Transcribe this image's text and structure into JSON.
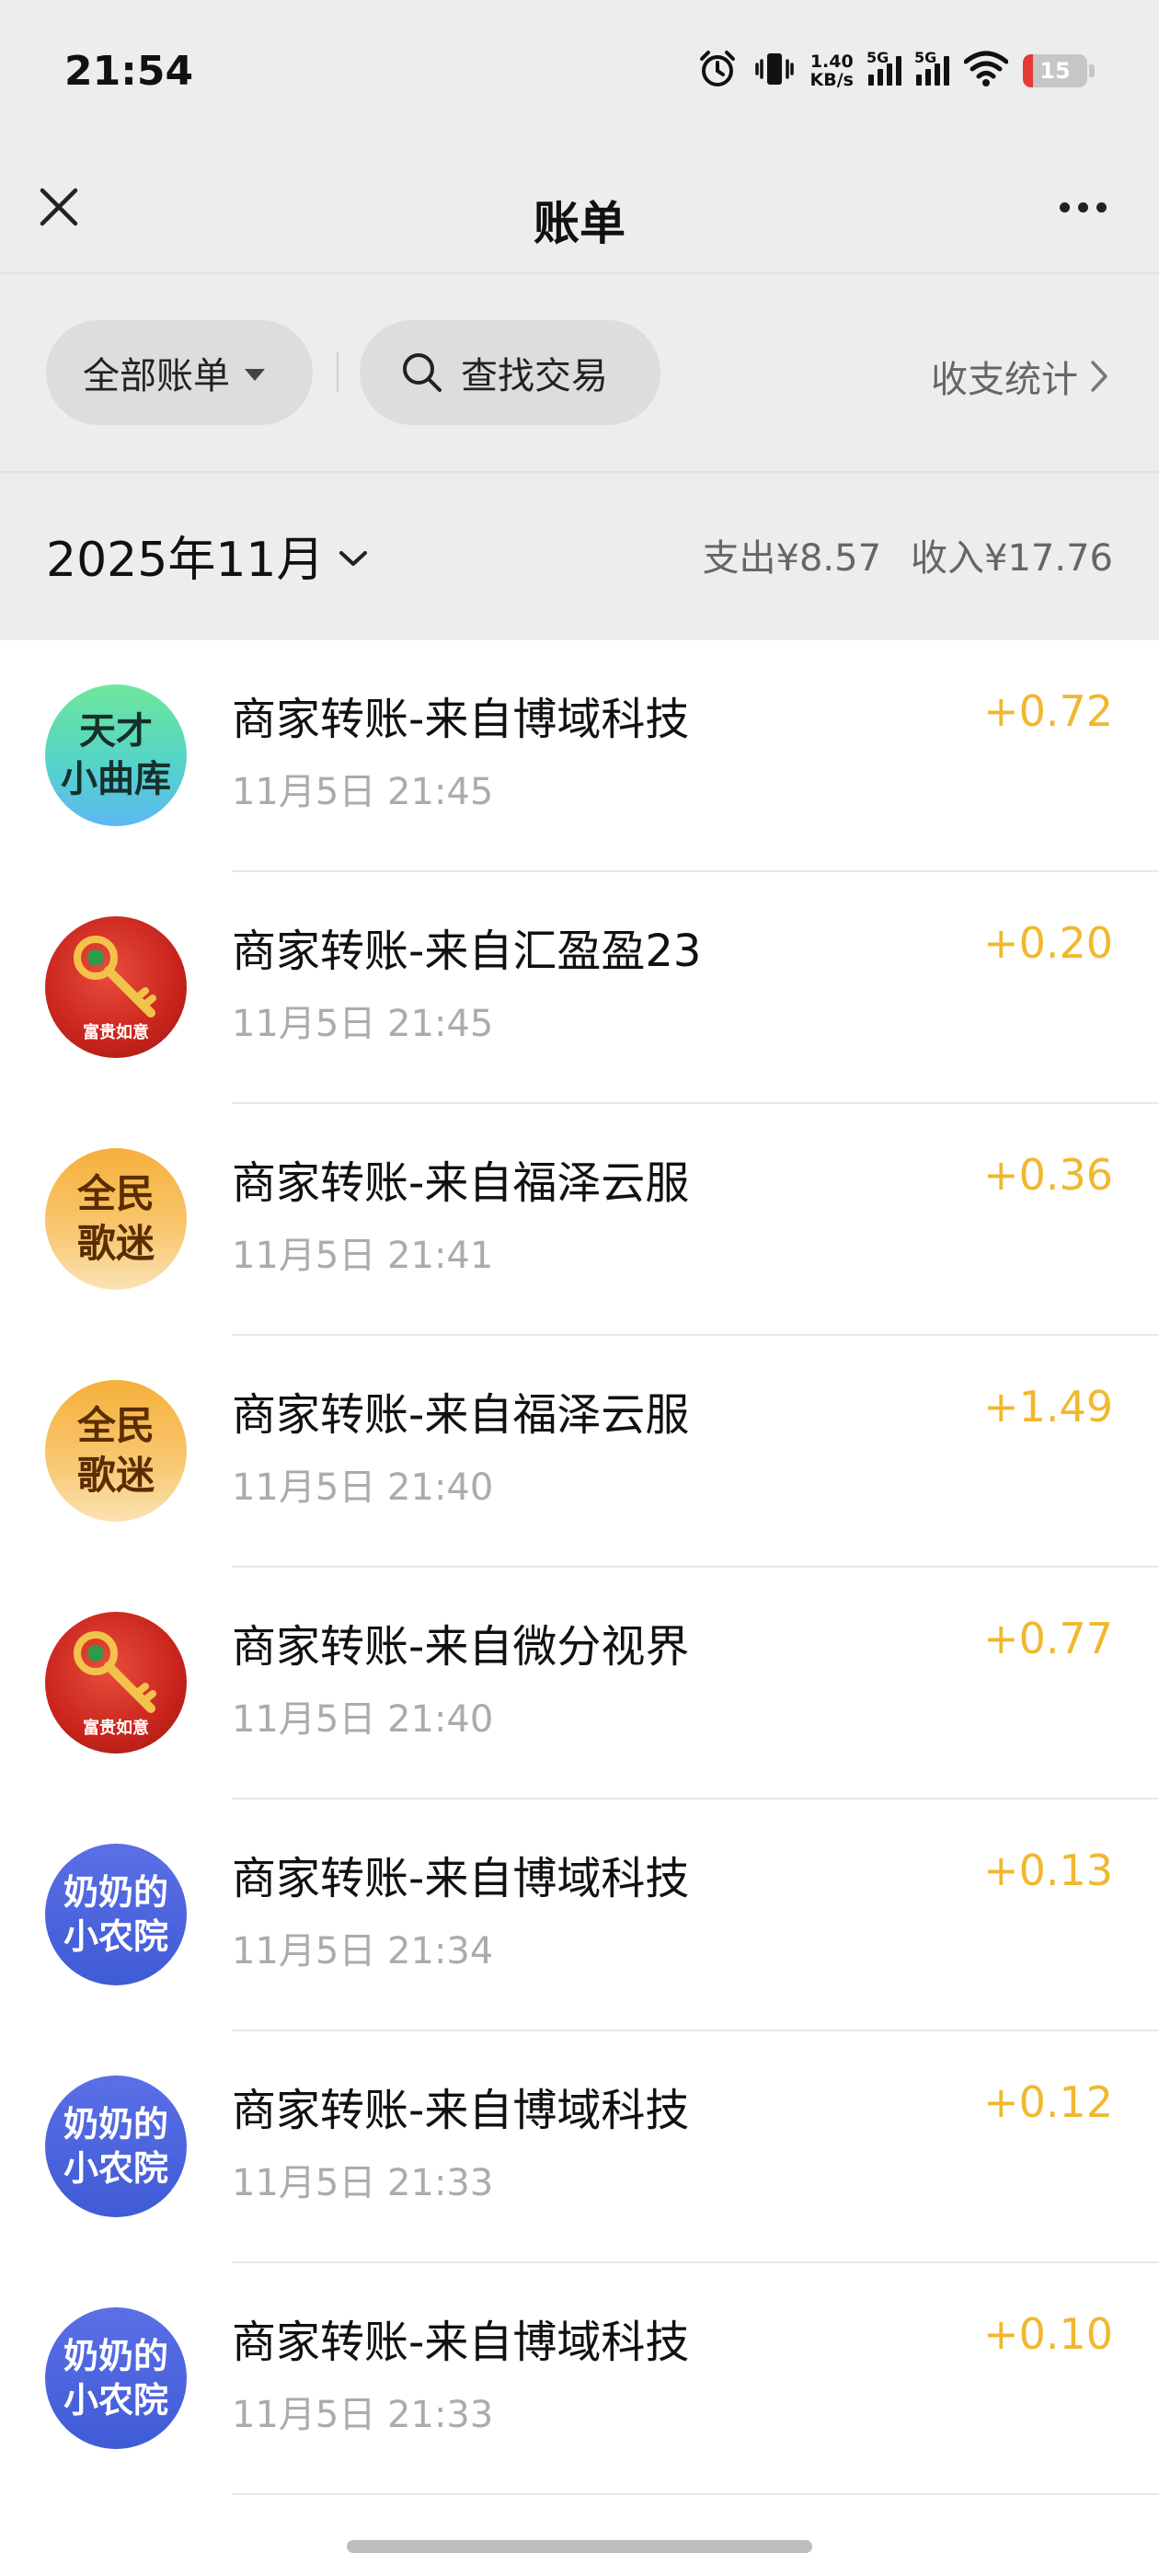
{
  "status_bar": {
    "time": "21:54",
    "net_speed_value": "1.40",
    "net_speed_unit": "KB/s",
    "signal_1_label": "5G",
    "signal_2_label": "5G",
    "battery_level": "15",
    "battery_fraction": 0.15,
    "battery_color": "#e53935",
    "icons": [
      "alarm-icon",
      "vibrate-icon",
      "signal-icon",
      "signal-icon",
      "wifi-icon",
      "battery-icon"
    ]
  },
  "nav": {
    "title": "账单",
    "close_icon": "close-icon",
    "more_icon": "more-icon"
  },
  "filter": {
    "all_bills_label": "全部账单",
    "search_label": "查找交易",
    "stats_label": "收支统计"
  },
  "month_bar": {
    "month_label": "2025年11月",
    "expense_label": "支出¥8.57",
    "income_label": "收入¥17.76"
  },
  "colors": {
    "income_amount": "#f0b82e",
    "background": "#ededed"
  },
  "transactions": [
    {
      "avatar_text_1": "天才",
      "avatar_text_2": "小曲库",
      "avatar_style": "music",
      "title": "商家转账-来自博域科技",
      "time": "11月5日 21:45",
      "amount": "+0.72"
    },
    {
      "avatar_text_1": "",
      "avatar_text_2": "富贵如意",
      "avatar_style": "key",
      "title": "商家转账-来自汇盈盈23",
      "time": "11月5日 21:45",
      "amount": "+0.20"
    },
    {
      "avatar_text_1": "全民",
      "avatar_text_2": "歌迷",
      "avatar_style": "songs",
      "title": "商家转账-来自福泽云服",
      "time": "11月5日 21:41",
      "amount": "+0.36"
    },
    {
      "avatar_text_1": "全民",
      "avatar_text_2": "歌迷",
      "avatar_style": "songs",
      "title": "商家转账-来自福泽云服",
      "time": "11月5日 21:40",
      "amount": "+1.49"
    },
    {
      "avatar_text_1": "",
      "avatar_text_2": "富贵如意",
      "avatar_style": "key",
      "title": "商家转账-来自微分视界",
      "time": "11月5日 21:40",
      "amount": "+0.77"
    },
    {
      "avatar_text_1": "奶奶的",
      "avatar_text_2": "小农院",
      "avatar_style": "farm",
      "title": "商家转账-来自博域科技",
      "time": "11月5日 21:34",
      "amount": "+0.13"
    },
    {
      "avatar_text_1": "奶奶的",
      "avatar_text_2": "小农院",
      "avatar_style": "farm",
      "title": "商家转账-来自博域科技",
      "time": "11月5日 21:33",
      "amount": "+0.12"
    },
    {
      "avatar_text_1": "奶奶的",
      "avatar_text_2": "小农院",
      "avatar_style": "farm",
      "title": "商家转账-来自博域科技",
      "time": "11月5日 21:33",
      "amount": "+0.10"
    }
  ]
}
